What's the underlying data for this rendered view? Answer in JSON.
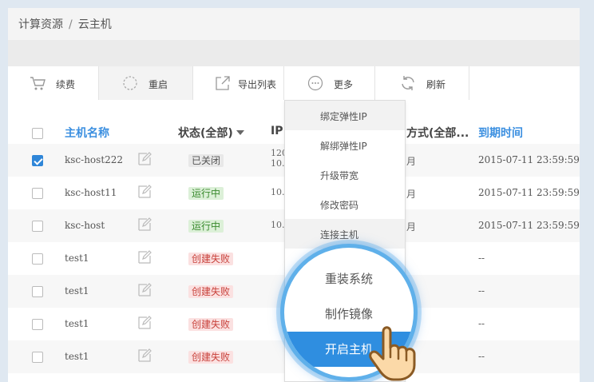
{
  "breadcrumb": {
    "root": "计算资源",
    "sep": "/",
    "current": "云主机"
  },
  "toolbar": {
    "renew": "续费",
    "restart": "重启",
    "export": "导出列表",
    "more": "更多",
    "refresh": "刷新"
  },
  "table": {
    "headers": {
      "name": "主机名称",
      "status": "状态(全部)",
      "ip": "IP",
      "pay": "方式(全部...",
      "expire": "到期时间"
    },
    "rows": [
      {
        "name": "ksc-host222",
        "status": "已关闭",
        "status_type": "off",
        "ip1": "120.",
        "ip2": "10.",
        "pay": "月",
        "expire": "2015-07-11 23:59:59",
        "checked": true
      },
      {
        "name": "ksc-host11",
        "status": "运行中",
        "status_type": "run",
        "ip1": "10.",
        "pay": "月",
        "expire": "2015-07-11 23:59:59",
        "checked": false
      },
      {
        "name": "ksc-host",
        "status": "运行中",
        "status_type": "run",
        "ip1": "10.",
        "pay": "月",
        "expire": "2015-07-11 23:59:59",
        "checked": false
      },
      {
        "name": "test1",
        "status": "创建失败",
        "status_type": "fail",
        "expire": "--",
        "checked": false
      },
      {
        "name": "test1",
        "status": "创建失败",
        "status_type": "fail",
        "expire": "--",
        "checked": false
      },
      {
        "name": "test1",
        "status": "创建失败",
        "status_type": "fail",
        "expire": "--",
        "checked": false
      },
      {
        "name": "test1",
        "status": "创建失败",
        "status_type": "fail",
        "expire": "--",
        "checked": false
      }
    ]
  },
  "more_menu": {
    "items": [
      "绑定弹性IP",
      "解绑弹性IP",
      "升级带宽",
      "修改密码",
      "连接主机"
    ]
  },
  "magnifier": {
    "items": [
      "重装系统",
      "制作镜像",
      "开启主机"
    ],
    "highlight": "开启主机"
  },
  "colors": {
    "accent": "#3b8fe0",
    "highlight": "#2f8ee0",
    "run_text": "#3a8a2e",
    "fail_text": "#c8413b"
  }
}
